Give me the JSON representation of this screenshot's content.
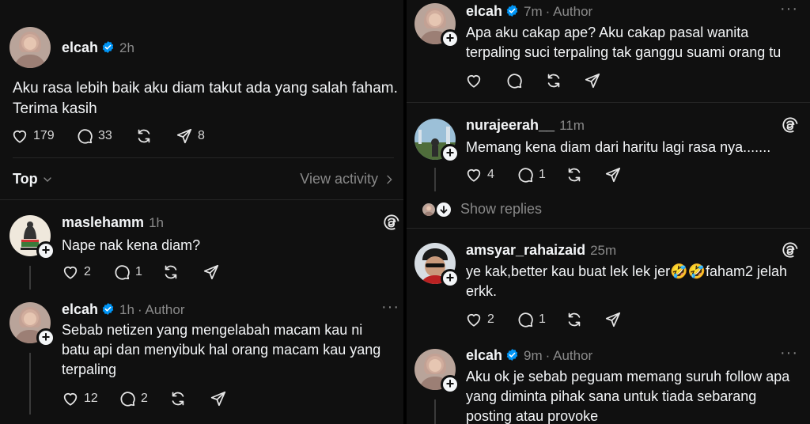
{
  "main_post": {
    "username": "elcah",
    "time": "2h",
    "text_line1": "Aku rasa lebih baik aku diam takut ada yang salah faham.",
    "text_line2": "Terima kasih",
    "likes": "179",
    "replies": "33",
    "shares": "8"
  },
  "sort": {
    "label": "Top",
    "view_activity": "View activity"
  },
  "left_replies": [
    {
      "username": "maslehamm",
      "time": "1h",
      "text": "Nape nak kena diam?",
      "likes": "2",
      "replies": "1"
    },
    {
      "username": "elcah",
      "time": "1h",
      "author": "· Author",
      "line1": "Sebab netizen yang mengelabah macam kau ni",
      "line2": "batu api dan menyibuk hal orang macam kau yang",
      "line3": "terpaling",
      "likes": "12",
      "replies": "2"
    }
  ],
  "right_replies": [
    {
      "username": "elcah",
      "time": "7m",
      "author": "· Author",
      "line1": "Apa aku cakap ape? Aku cakap pasal wanita",
      "line2": "terpaling suci terpaling tak ganggu suami orang tu"
    },
    {
      "username": "nurajeerah__",
      "time": "11m",
      "text": "Memang kena diam dari haritu lagi rasa nya.......",
      "likes": "4",
      "replies": "1"
    },
    {
      "username": "amsyar_rahaizaid",
      "time": "25m",
      "line1": "ye kak,better kau buat lek lek jer🤣🤣faham2 jelah",
      "line2": "erkk.",
      "likes": "2",
      "replies": "1"
    },
    {
      "username": "elcah",
      "time": "9m",
      "author": "· Author",
      "line1": "Aku ok je sebab peguam memang suruh follow apa",
      "line2": "yang diminta pihak sana untuk tiada sebarang",
      "line3": "posting atau provoke"
    }
  ],
  "show_replies": "Show replies",
  "colors": {
    "background": "#101010",
    "verified": "#0095f6",
    "text": "#f3f5f7",
    "muted": "#777777"
  }
}
